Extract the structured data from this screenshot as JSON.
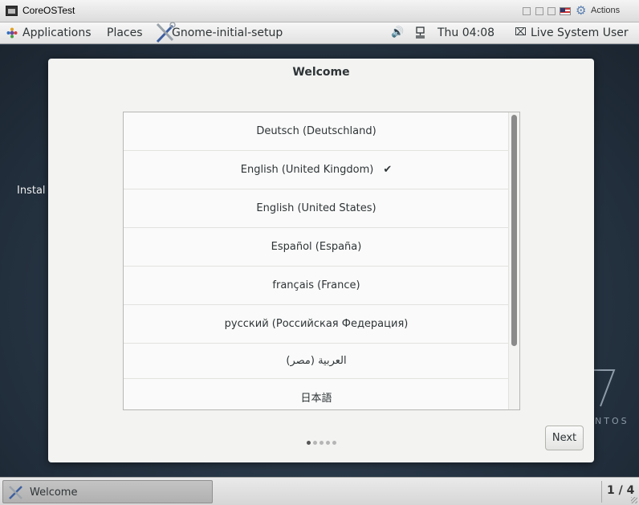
{
  "vm_window": {
    "title": "CoreOSTest",
    "actions_label": "Actions",
    "icons": [
      "vm-monitor-icon",
      "minimize-icon",
      "maximize-icon",
      "close-icon",
      "flag-icon",
      "gear-icon"
    ]
  },
  "topbar": {
    "applications": "Applications",
    "places": "Places",
    "active_app": "Gnome-initial-setup",
    "clock": "Thu 04:08",
    "user": "Live System User"
  },
  "desktop": {
    "partial_text": "Instal",
    "brand_text": "NTOS"
  },
  "dialog": {
    "title": "Welcome",
    "languages": [
      {
        "label": "Deutsch (Deutschland)",
        "selected": false
      },
      {
        "label": "English (United Kingdom)",
        "selected": true
      },
      {
        "label": "English (United States)",
        "selected": false
      },
      {
        "label": "Español (España)",
        "selected": false
      },
      {
        "label": "français (France)",
        "selected": false
      },
      {
        "label": "русский (Российская Федерация)",
        "selected": false
      },
      {
        "label": "العربية (مصر)",
        "selected": false
      },
      {
        "label": "日本語",
        "selected": false
      }
    ],
    "check_mark": "✔",
    "page_dots": 5,
    "active_page": 1,
    "next_label": "Next"
  },
  "taskbar": {
    "window_label": "Welcome",
    "workspace": "1 / 4"
  },
  "colors": {
    "desktop": "#263443",
    "dialog": "#f3f3f2",
    "panel": "#e2e2e2"
  }
}
